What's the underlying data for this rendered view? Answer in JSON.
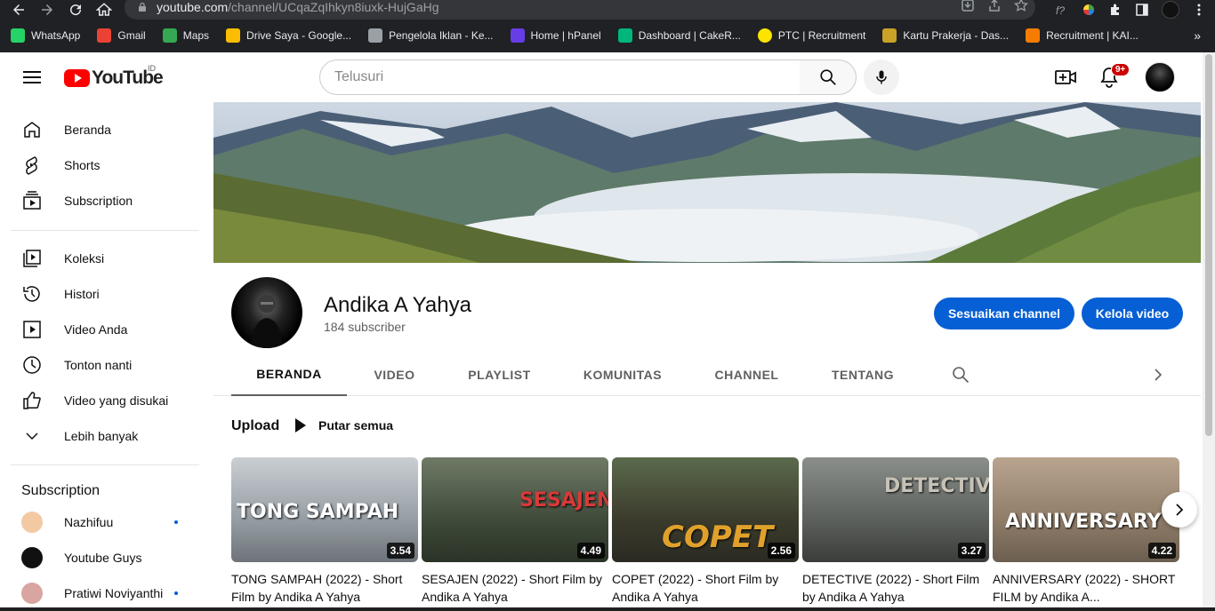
{
  "browser": {
    "url_host": "youtube.com",
    "url_path": "/channel/UCqaZqIhkyn8iuxk-HujGaHg",
    "bookmarks": [
      {
        "label": "WhatsApp",
        "icon": "whatsapp-icon",
        "color": "#25d366"
      },
      {
        "label": "Gmail",
        "icon": "gmail-icon",
        "color": "#ea4335"
      },
      {
        "label": "Maps",
        "icon": "maps-icon",
        "color": "#34a853"
      },
      {
        "label": "Drive Saya - Google...",
        "icon": "drive-icon",
        "color": "#fbbc04"
      },
      {
        "label": "Pengelola Iklan - Ke...",
        "icon": "ads-icon",
        "color": "#9aa0a6"
      },
      {
        "label": "Home | hPanel",
        "icon": "hpanel-icon",
        "color": "#673de6"
      },
      {
        "label": "Dashboard | CakeR...",
        "icon": "cakeresume-icon",
        "color": "#00b67a"
      },
      {
        "label": "PTC | Recruitment",
        "icon": "ptc-icon",
        "color": "#fce300"
      },
      {
        "label": "Kartu Prakerja - Das...",
        "icon": "garuda-icon",
        "color": "#c9a227"
      },
      {
        "label": "Recruitment | KAI...",
        "icon": "kai-icon",
        "color": "#f57c00"
      }
    ],
    "bookmarks_more": "»"
  },
  "header": {
    "logo_text": "YouTube",
    "region": "ID",
    "search_placeholder": "Telusuri",
    "notification_count": "9+"
  },
  "sidebar": {
    "main_items": [
      {
        "label": "Beranda",
        "icon": "home-icon"
      },
      {
        "label": "Shorts",
        "icon": "shorts-icon"
      },
      {
        "label": "Subscription",
        "icon": "subscriptions-icon"
      }
    ],
    "library_items": [
      {
        "label": "Koleksi",
        "icon": "library-icon"
      },
      {
        "label": "Histori",
        "icon": "history-icon"
      },
      {
        "label": "Video Anda",
        "icon": "your-videos-icon"
      },
      {
        "label": "Tonton nanti",
        "icon": "watch-later-icon"
      },
      {
        "label": "Video yang disukai",
        "icon": "liked-icon"
      },
      {
        "label": "Lebih banyak",
        "icon": "chevron-down-icon"
      }
    ],
    "subscription_heading": "Subscription",
    "subscriptions": [
      {
        "name": "Nazhifuu",
        "new": true
      },
      {
        "name": "Youtube Guys",
        "new": false
      },
      {
        "name": "Pratiwi Noviyanthi",
        "new": true
      }
    ]
  },
  "channel": {
    "name": "Andika A Yahya",
    "subscribers": "184 subscriber",
    "customize_label": "Sesuaikan channel",
    "manage_label": "Kelola video"
  },
  "tabs": [
    "BERANDA",
    "VIDEO",
    "PLAYLIST",
    "KOMUNITAS",
    "CHANNEL",
    "TENTANG"
  ],
  "shelf": {
    "title": "Upload",
    "play_all": "Putar semua"
  },
  "videos": [
    {
      "title": "TONG SAMPAH (2022) - Short Film by Andika A Yahya",
      "duration": "3.54",
      "art": "TONG SAMPAH"
    },
    {
      "title": "SESAJEN (2022) - Short Film by Andika A Yahya",
      "duration": "4.49",
      "art": "SESAJEN"
    },
    {
      "title": "COPET (2022) - Short Film by Andika A Yahya",
      "duration": "2.56",
      "art": "COPET"
    },
    {
      "title": "DETECTIVE (2022) - Short Film by Andika A Yahya",
      "duration": "3.27",
      "art": "DETECTIVE"
    },
    {
      "title": "ANNIVERSARY (2022) - SHORT FILM by Andika A...",
      "duration": "4.22",
      "art": "ANNIVERSARY"
    }
  ]
}
